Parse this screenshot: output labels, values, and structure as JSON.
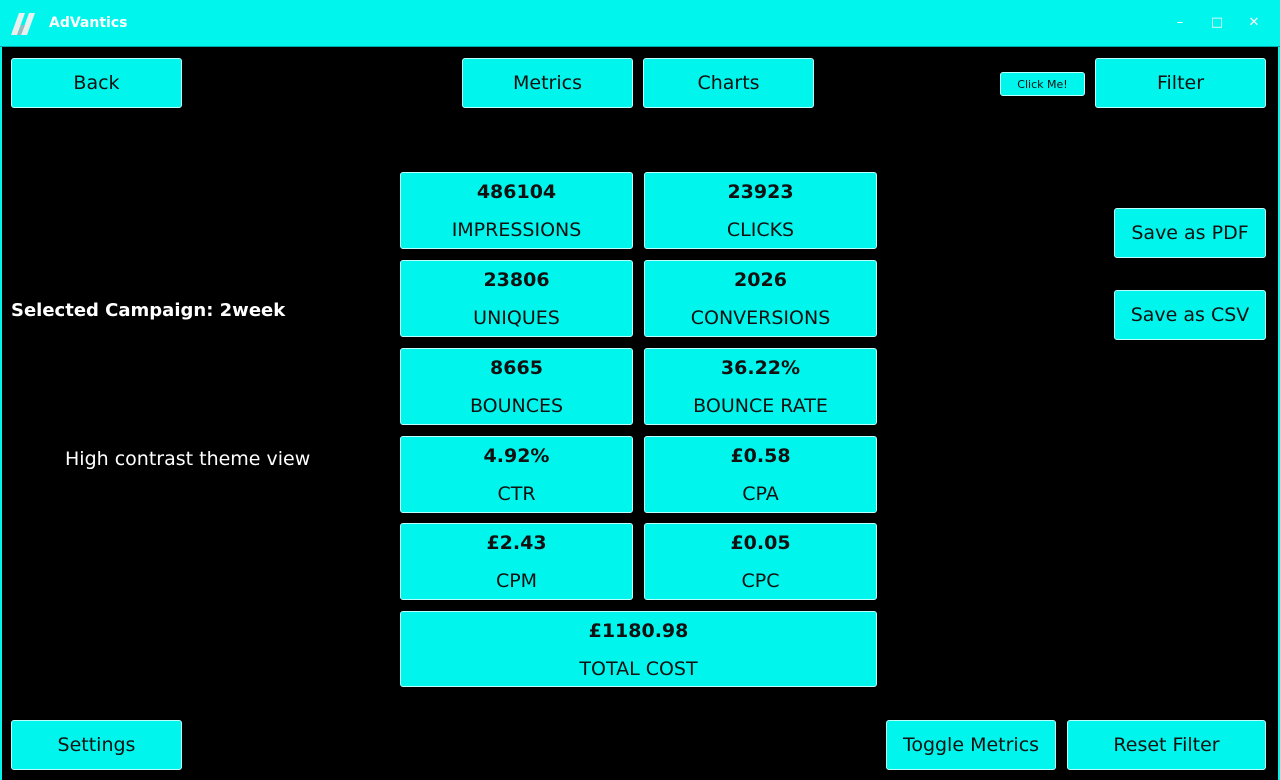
{
  "window": {
    "title": "AdVantics",
    "controls": {
      "minimize": "–",
      "maximize": "□",
      "close": "✕"
    }
  },
  "toolbar": {
    "back": "Back",
    "metrics": "Metrics",
    "charts": "Charts",
    "click_me": "Click Me!",
    "filter": "Filter"
  },
  "side_actions": {
    "save_pdf": "Save as PDF",
    "save_csv": "Save as CSV"
  },
  "campaign": {
    "label": "Selected Campaign: 2week"
  },
  "theme_note": "High contrast theme view",
  "metrics": [
    {
      "value": "486104",
      "label": "IMPRESSIONS"
    },
    {
      "value": "23923",
      "label": "CLICKS"
    },
    {
      "value": "23806",
      "label": "UNIQUES"
    },
    {
      "value": "2026",
      "label": "CONVERSIONS"
    },
    {
      "value": "8665",
      "label": "BOUNCES"
    },
    {
      "value": "36.22%",
      "label": "BOUNCE RATE"
    },
    {
      "value": "4.92%",
      "label": "CTR"
    },
    {
      "value": "£0.58",
      "label": "CPA"
    },
    {
      "value": "£2.43",
      "label": "CPM"
    },
    {
      "value": "£0.05",
      "label": "CPC"
    },
    {
      "value": "£1180.98",
      "label": "TOTAL COST"
    }
  ],
  "bottom": {
    "settings": "Settings",
    "toggle_metrics": "Toggle Metrics",
    "reset_filter": "Reset Filter"
  },
  "colors": {
    "accent": "#00f5ec",
    "background": "#000000",
    "text": "#111111"
  }
}
